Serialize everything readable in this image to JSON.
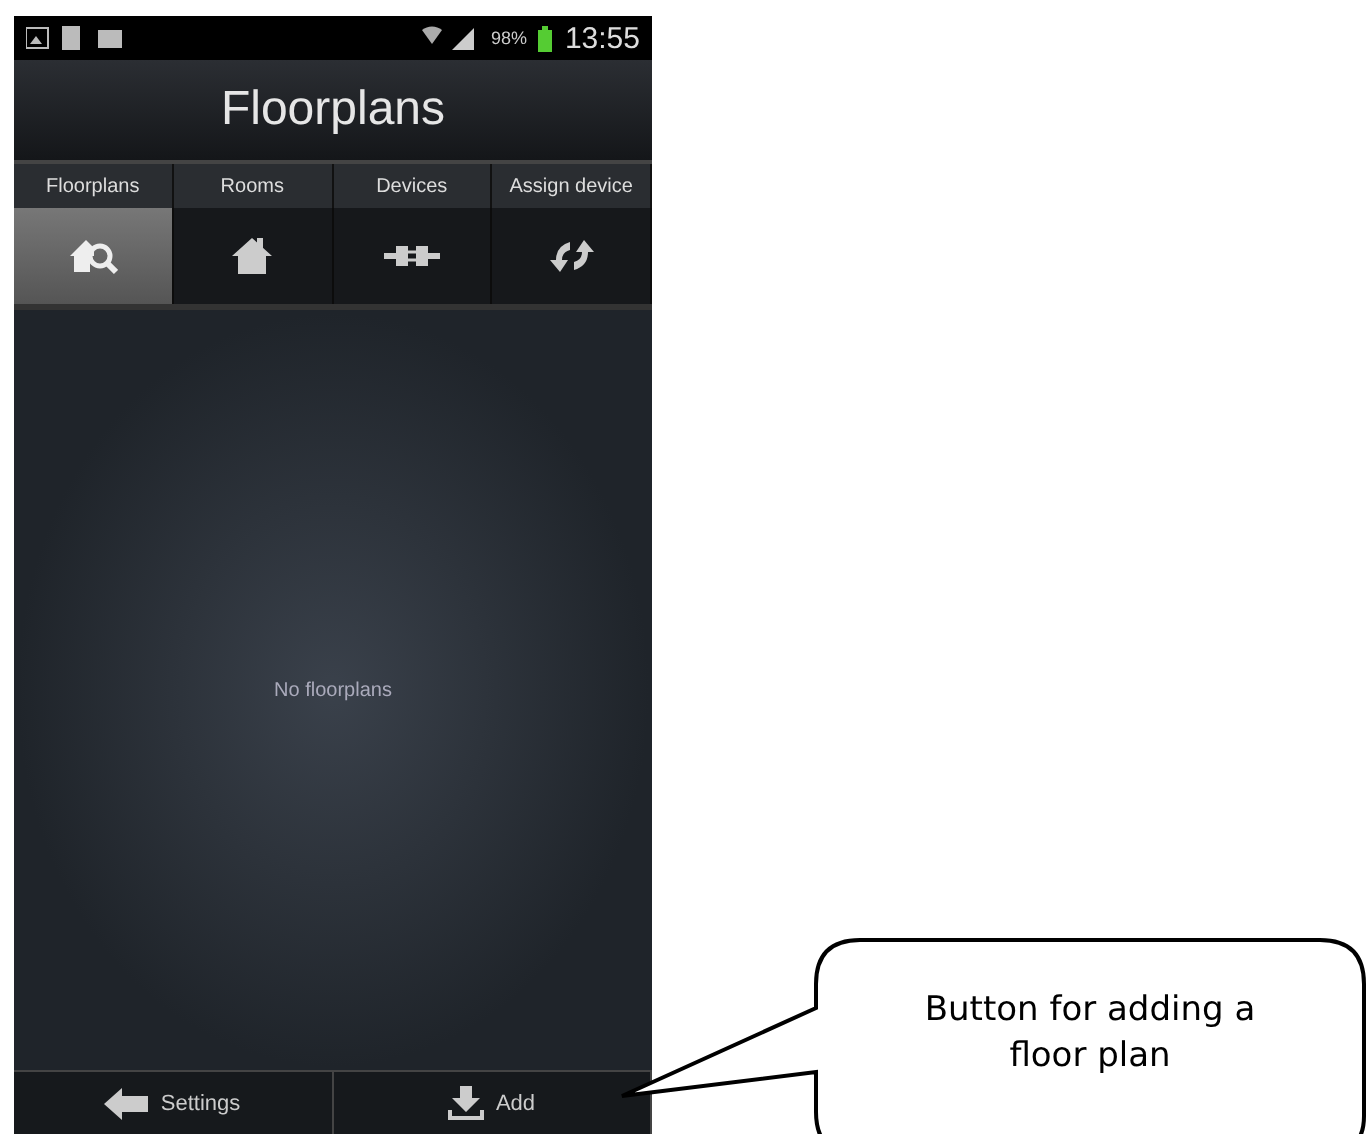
{
  "status_bar": {
    "battery": "98%",
    "time": "13:55"
  },
  "title": "Floorplans",
  "tabs": [
    {
      "label": "Floorplans",
      "kind": "find-home",
      "selected": true
    },
    {
      "label": "Rooms",
      "kind": "home",
      "selected": false
    },
    {
      "label": "Devices",
      "kind": "plug",
      "selected": false
    },
    {
      "label": "Assign device",
      "kind": "sync",
      "selected": false
    }
  ],
  "empty_message": "No floorplans",
  "bottom_bar": [
    {
      "label": "Settings",
      "kind": "back"
    },
    {
      "label": "Add",
      "kind": "add"
    }
  ],
  "callout": {
    "text": "Button for adding a floor plan"
  }
}
